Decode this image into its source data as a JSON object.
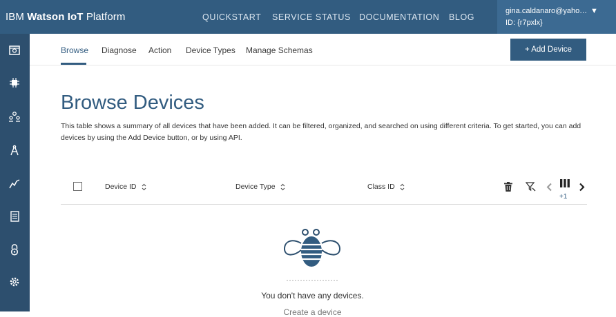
{
  "header": {
    "brand_prefix": "IBM",
    "brand_bold": "Watson IoT",
    "brand_suffix": "Platform",
    "nav": [
      "QUICKSTART",
      "SERVICE STATUS",
      "DOCUMENTATION",
      "BLOG"
    ],
    "user_email": "gina.caldanaro@yaho…",
    "user_id": "ID: {r7pxlx}",
    "caret": "▼"
  },
  "sidebar": {
    "icons": [
      "dashboard-icon",
      "chip-icon",
      "members-icon",
      "compass-icon",
      "activity-icon",
      "document-icon",
      "lock-icon",
      "settings-icon"
    ]
  },
  "subnav": {
    "tabs": [
      "Browse",
      "Diagnose",
      "Action",
      "Device Types",
      "Manage Schemas"
    ],
    "active_tab": "Browse",
    "add_button": "+ Add Device"
  },
  "main": {
    "title": "Browse Devices",
    "description": "This table shows a summary of all devices that have been added. It can be filtered, organized, and searched on using different criteria. To get started, you can add devices by using the Add Device button, or by using API."
  },
  "table": {
    "columns": [
      "Device ID",
      "Device Type",
      "Class ID"
    ],
    "toolbar_icons": [
      "trash-icon",
      "filter-icon",
      "chevron-left-icon",
      "columns-icon",
      "chevron-right-icon"
    ],
    "hidden_columns_badge": "+1"
  },
  "empty_state": {
    "message": "You don't have any devices.",
    "sub_message": "Create a device"
  },
  "colors": {
    "brand": "#325c80",
    "sidebar": "#2d4f6e",
    "user_panel": "#3c6a92"
  }
}
